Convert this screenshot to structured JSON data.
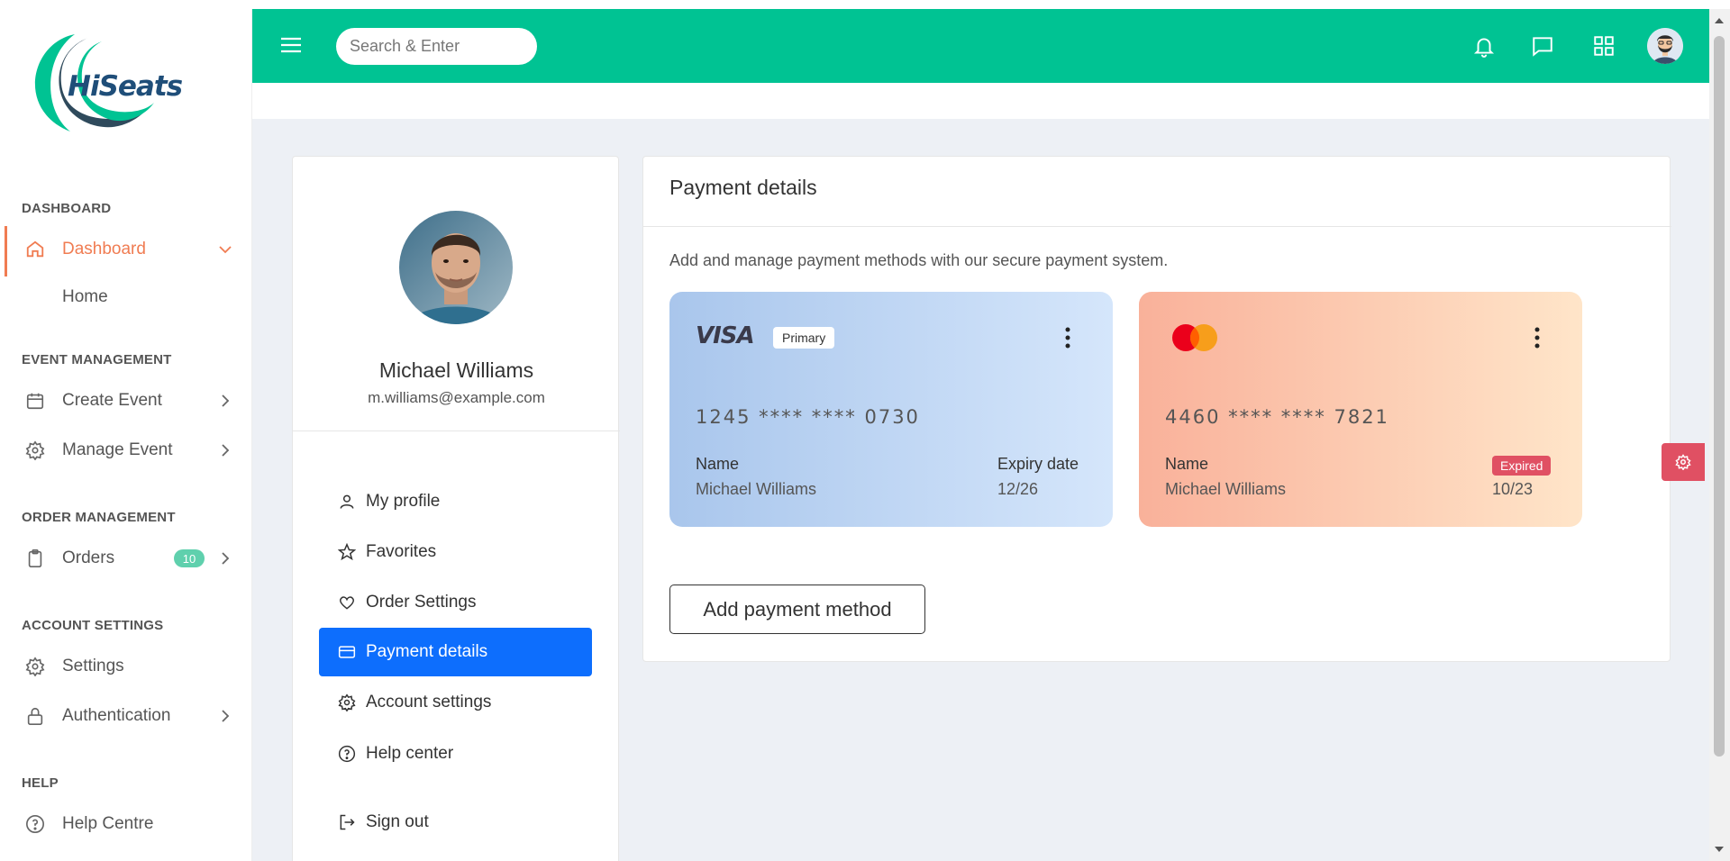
{
  "brand": {
    "name": "HiSeats"
  },
  "sidebar": {
    "sections": {
      "dashboard": "DASHBOARD",
      "event_management": "EVENT MANAGEMENT",
      "order_management": "ORDER MANAGEMENT",
      "account_settings": "ACCOUNT SETTINGS",
      "help": "HELP"
    },
    "items": {
      "dashboard": "Dashboard",
      "home": "Home",
      "create_event": "Create Event",
      "manage_event": "Manage Event",
      "orders": "Orders",
      "orders_badge": "10",
      "settings": "Settings",
      "authentication": "Authentication",
      "help_centre": "Help Centre"
    },
    "accent": "#f07c52"
  },
  "header": {
    "search_placeholder": "Search & Enter",
    "background": "#00c393"
  },
  "profile": {
    "name": "Michael Williams",
    "email": "m.williams@example.com",
    "menu": {
      "my_profile": "My profile",
      "favorites": "Favorites",
      "order_settings": "Order Settings",
      "payment_details": "Payment details",
      "account_settings": "Account settings",
      "help_center": "Help center",
      "sign_out": "Sign out"
    },
    "active_item": "Payment details"
  },
  "payment": {
    "title": "Payment details",
    "description": "Add and manage payment methods with our secure payment system.",
    "cards": [
      {
        "brand_icon": "visa-logo",
        "brand_text": "VISA",
        "badge": "Primary",
        "number": "1245 **** **** 0730",
        "name_label": "Name",
        "name": "Michael Williams",
        "expiry_label": "Expiry date",
        "expiry": "12/26"
      },
      {
        "brand_icon": "mastercard-logo",
        "number": "4460 **** **** 7821",
        "name_label": "Name",
        "name": "Michael Williams",
        "status": "Expired",
        "expiry": "10/23"
      }
    ],
    "add_button": "Add payment method"
  }
}
